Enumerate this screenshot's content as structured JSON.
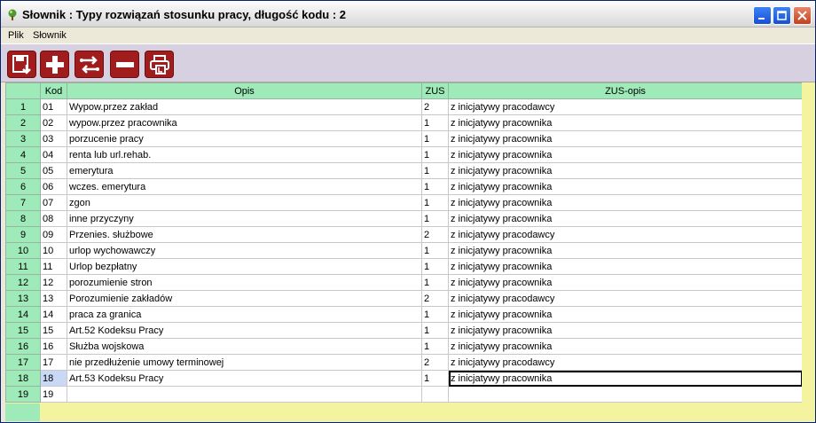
{
  "window": {
    "title": "Słownik : Typy rozwiązań stosunku pracy,  długość kodu : 2"
  },
  "menu": {
    "items": [
      "Plik",
      "Słownik"
    ]
  },
  "toolbar": {
    "buttons": [
      "save-export-icon",
      "add-icon",
      "swap-icon",
      "remove-icon",
      "print-icon"
    ],
    "color": "#a11c1c"
  },
  "table": {
    "headers": [
      "",
      "Kod",
      "Opis",
      "ZUS",
      "ZUS-opis"
    ],
    "rows": [
      {
        "n": "1",
        "kod": "01",
        "opis": "Wypow.przez zakład",
        "zus": "2",
        "zus_opis": "z inicjatywy pracodawcy"
      },
      {
        "n": "2",
        "kod": "02",
        "opis": "wypow.przez pracownika",
        "zus": "1",
        "zus_opis": "z inicjatywy pracownika"
      },
      {
        "n": "3",
        "kod": "03",
        "opis": "porzucenie pracy",
        "zus": "1",
        "zus_opis": "z inicjatywy pracownika"
      },
      {
        "n": "4",
        "kod": "04",
        "opis": "renta lub url.rehab.",
        "zus": "1",
        "zus_opis": "z inicjatywy pracownika"
      },
      {
        "n": "5",
        "kod": "05",
        "opis": "emerytura",
        "zus": "1",
        "zus_opis": "z inicjatywy pracownika"
      },
      {
        "n": "6",
        "kod": "06",
        "opis": "wczes. emerytura",
        "zus": "1",
        "zus_opis": "z inicjatywy pracownika"
      },
      {
        "n": "7",
        "kod": "07",
        "opis": "zgon",
        "zus": "1",
        "zus_opis": "z inicjatywy pracownika"
      },
      {
        "n": "8",
        "kod": "08",
        "opis": "inne przyczyny",
        "zus": "1",
        "zus_opis": "z inicjatywy pracownika"
      },
      {
        "n": "9",
        "kod": "09",
        "opis": "Przenies. służbowe",
        "zus": "2",
        "zus_opis": "z inicjatywy pracodawcy"
      },
      {
        "n": "10",
        "kod": "10",
        "opis": "urlop wychowawczy",
        "zus": "1",
        "zus_opis": "z inicjatywy pracownika"
      },
      {
        "n": "11",
        "kod": "11",
        "opis": "Urlop bezpłatny",
        "zus": "1",
        "zus_opis": "z inicjatywy pracownika"
      },
      {
        "n": "12",
        "kod": "12",
        "opis": "porozumienie stron",
        "zus": "1",
        "zus_opis": "z inicjatywy pracownika"
      },
      {
        "n": "13",
        "kod": "13",
        "opis": "Porozumienie zakładów",
        "zus": "2",
        "zus_opis": "z inicjatywy pracodawcy"
      },
      {
        "n": "14",
        "kod": "14",
        "opis": "praca za granica",
        "zus": "1",
        "zus_opis": "z inicjatywy pracownika"
      },
      {
        "n": "15",
        "kod": "15",
        "opis": "Art.52 Kodeksu Pracy",
        "zus": "1",
        "zus_opis": "z inicjatywy pracownika"
      },
      {
        "n": "16",
        "kod": "16",
        "opis": "Służba wojskowa",
        "zus": "1",
        "zus_opis": "z inicjatywy pracownika"
      },
      {
        "n": "17",
        "kod": "17",
        "opis": "nie przedłużenie umowy terminowej",
        "zus": "2",
        "zus_opis": "z inicjatywy pracodawcy"
      },
      {
        "n": "18",
        "kod": "18",
        "opis": "Art.53 Kodeksu Pracy",
        "zus": "1",
        "zus_opis": "z inicjatywy pracownika"
      },
      {
        "n": "19",
        "kod": "19",
        "opis": "",
        "zus": "",
        "zus_opis": ""
      }
    ],
    "selected_row": "18"
  },
  "colors": {
    "header_bg": "#9eeab8",
    "grid_bg": "#f4f4a0",
    "selected_cell": "#c9d8f4"
  }
}
